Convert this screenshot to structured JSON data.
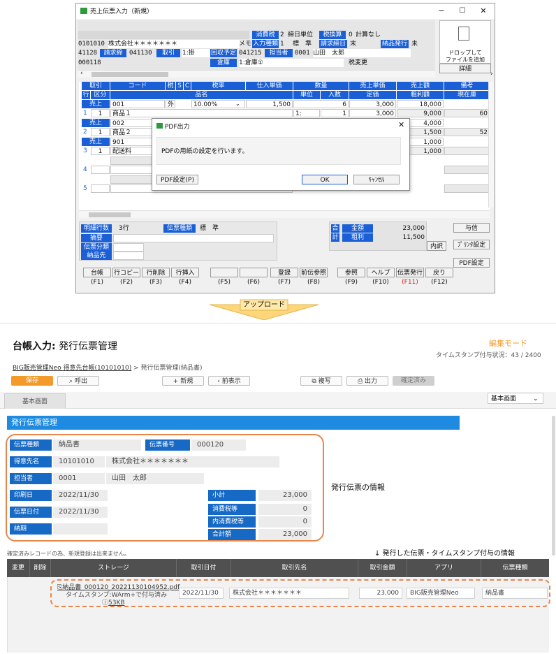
{
  "app": {
    "title": "売上伝票入力（新規）",
    "min": "−",
    "max": "☐",
    "close": "✕"
  },
  "header": {
    "tax_label": "消費税",
    "tax_value": "2",
    "closing_unit_label": "締日単位",
    "tax_conv_label": "税換算",
    "tax_conv_value": "0",
    "calc_label": "計算なし",
    "customer_code": "0101010",
    "customer_name": "株式会社＊＊＊＊＊＊＊",
    "memo_label": "メモ",
    "input_type_label": "入力種類",
    "input_type_value": "1",
    "standard": "標　準",
    "bill_closing_label": "請求締日",
    "bill_closing_value": "末",
    "delivery_issue_label": "納品発行",
    "delivery_issue_value": "未",
    "bill_to_code": "41128",
    "bill_to_label": "請求締",
    "bill_to_value": "041130",
    "transaction_label": "取引",
    "transaction_value": "1:掛",
    "collect_label": "回収予定",
    "collect_value": "041215",
    "staff_label": "担当者",
    "staff_code": "0001",
    "staff_name": "山田　太郎",
    "doc_no": "000118",
    "warehouse_label": "倉庫",
    "warehouse_value": "1:倉庫①",
    "tax_change": "税変更",
    "drop_label_1": "ドロップして",
    "drop_label_2": "ファイルを追加",
    "detail_btn": "詳細"
  },
  "grid": {
    "headers": {
      "torihiki": "取引",
      "code": "コード",
      "zei": "税",
      "s": "S",
      "c": "C",
      "rate": "税率",
      "cost_price": "仕入単価",
      "qty": "数量",
      "sale_price": "売上単価",
      "sale_amount": "売上額",
      "note": "備考",
      "gyo": "行",
      "kubun": "区分",
      "item_name": "品名",
      "unit": "単位",
      "irisu": "入数",
      "teika": "定価",
      "gross": "粗利額",
      "stock": "現在庫"
    },
    "rows": [
      {
        "no": "1",
        "kubun": "1",
        "torihiki": "売上",
        "code": "001",
        "tax": "外",
        "rate": "10.00%",
        "cost": "1,500",
        "name": "商品１",
        "unit": "1:",
        "irisu": "1",
        "qty": "6",
        "price": "3,000",
        "teika": "3,000",
        "amount": "18,000",
        "gross": "9,000",
        "stock": "60"
      },
      {
        "no": "2",
        "kubun": "1",
        "torihiki": "売上",
        "code": "002",
        "tax": "",
        "rate": "",
        "cost": "",
        "name": "商品２",
        "unit": "",
        "irisu": "",
        "qty": "",
        "price": "",
        "teika": "",
        "amount": "4,000",
        "gross": "1,500",
        "stock": "52"
      },
      {
        "no": "3",
        "kubun": "1",
        "torihiki": "売上",
        "code": "901",
        "tax": "",
        "rate": "",
        "cost": "",
        "name": "配送料",
        "unit": "",
        "irisu": "",
        "qty": "",
        "price": "",
        "teika": "",
        "amount": "1,000",
        "gross": "1,000",
        "stock": ""
      }
    ],
    "empty_rows": [
      "4",
      "5"
    ]
  },
  "dialog": {
    "title": "PDF出力",
    "message": "PDFの用紙の設定を行います。",
    "setting_btn": "PDF設定(P)",
    "ok_btn": "OK",
    "cancel_btn": "ｷｬﾝｾﾙ"
  },
  "footer": {
    "detail_count_label": "明細行数",
    "detail_count_value": "3行",
    "doc_type_label": "伝票種類",
    "doc_type_value": "標　準",
    "summary_label": "摘要",
    "doc_class_label": "伝票分類",
    "delivery_label": "納品先",
    "total_label_1": "合",
    "total_label_2": "計",
    "amount_label": "金額",
    "amount_value": "23,000",
    "gross_label": "粗利",
    "gross_value": "11,500",
    "naiyaku": "内訳",
    "credit_btn": "与信",
    "printer_btn": "ﾌﾟﾘﾝﾀ設定",
    "pdf_btn": "PDF設定"
  },
  "fkeys": [
    {
      "label": "台帳",
      "key": "(F1)"
    },
    {
      "label": "行コピー",
      "key": "(F2)"
    },
    {
      "label": "行削除",
      "key": "(F3)"
    },
    {
      "label": "行挿入",
      "key": "(F4)"
    },
    {
      "label": "",
      "key": "(F5)"
    },
    {
      "label": "",
      "key": "(F6)"
    },
    {
      "label": "登録",
      "key": "(F7)"
    },
    {
      "label": "前伝参照",
      "key": "(F8)"
    },
    {
      "label": "参照",
      "key": "(F9)"
    },
    {
      "label": "ヘルプ",
      "key": "(F10)"
    },
    {
      "label": "伝票発行",
      "key": "(F11)"
    },
    {
      "label": "戻り",
      "key": "(F12)"
    }
  ],
  "upload_label": "アップロード",
  "web": {
    "title_prefix": "台帳入力:",
    "title": "発行伝票管理",
    "mode": "編集モード",
    "timestamp_status": "タイムスタンプ付与状況：43 / 2400",
    "breadcrumb_link": "BIG販売管理Neo 得意先台帳(10101010)",
    "breadcrumb_rest": " > 発行伝票管理(納品書)",
    "save": "保存",
    "call": "呼出",
    "new": "新規",
    "prev": "前表示",
    "copy": "複写",
    "output": "出力",
    "confirmed": "確定済み",
    "tab": "基本画面",
    "view_select": "基本画面",
    "section_title": "発行伝票管理",
    "fields": {
      "doc_type_label": "伝票種類",
      "doc_type": "納品書",
      "doc_no_label": "伝票番号",
      "doc_no": "000120",
      "customer_label": "得意先名",
      "customer_code": "10101010",
      "customer_name": "株式会社＊＊＊＊＊＊＊",
      "staff_label": "担当者",
      "staff_code": "0001",
      "staff_name": "山田　太郎",
      "print_date_label": "印刷日",
      "print_date": "2022/11/30",
      "doc_date_label": "伝票日付",
      "doc_date": "2022/11/30",
      "due_label": "納期",
      "due": "",
      "subtotal_label": "小計",
      "subtotal": "23,000",
      "tax_label": "消費税等",
      "tax": "0",
      "intax_label": "内消費税等",
      "intax": "0",
      "total_label": "合計額",
      "total": "23,000"
    },
    "annotation_info": "発行伝票の情報",
    "notice": "確定済みレコードの為、新規登録は出来ません。",
    "annotation_ts": "↓ 発行した伝票・タイムスタンプ付与の情報",
    "table_headers": [
      "変更",
      "削除",
      "ストレージ",
      "取引日付",
      "取引先名",
      "取引金額",
      "アプリ",
      "伝票種類"
    ],
    "record": {
      "file": "納品書_000120_20221130104952.pdf",
      "timestamp": "タイムスタンプ:WArm+で付与済み",
      "size": "53KB",
      "date": "2022/11/30",
      "partner": "株式会社＊＊＊＊＊＊＊",
      "amount": "23,000",
      "app": "BIG販売管理Neo",
      "doc_type": "納品書"
    }
  }
}
